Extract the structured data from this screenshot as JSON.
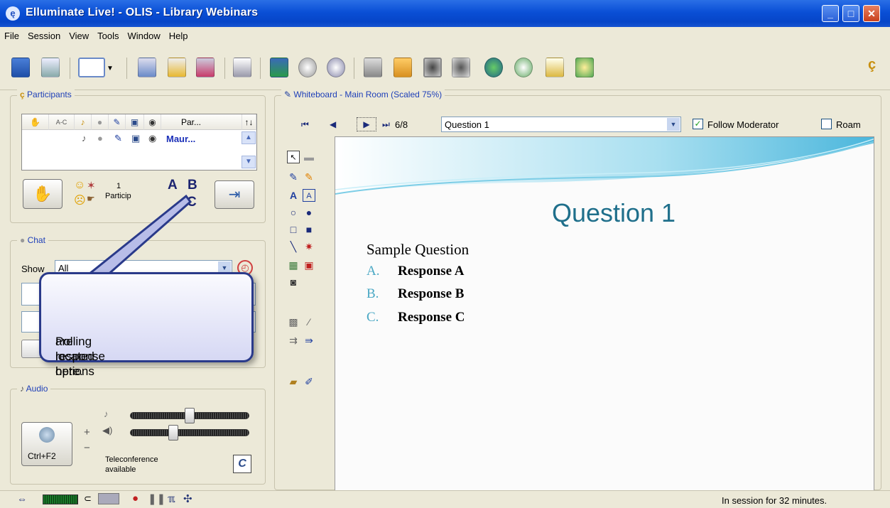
{
  "window": {
    "title": "Elluminate Live! - OLIS - Library Webinars"
  },
  "menu": [
    "File",
    "Session",
    "View",
    "Tools",
    "Window",
    "Help"
  ],
  "toolbar_icons": [
    "save-icon",
    "print-icon",
    "layout-icon",
    "dropdown-arrow-icon",
    "eye-icon",
    "lock-icon",
    "align-icon",
    "projector-icon",
    "desktop-share-icon",
    "cd-icon",
    "settings-icon",
    "load-icon",
    "webcam-icon",
    "webcam-group-icon",
    "globe-icon",
    "timer-icon",
    "notepad-icon",
    "add-user-icon",
    "presence-icon"
  ],
  "participants": {
    "title": "Participants",
    "columns": [
      "",
      "A-C",
      "",
      "",
      "",
      "",
      "",
      "Par..."
    ],
    "sort_label": "↑↓",
    "rows": [
      {
        "name": "Maur..."
      }
    ],
    "count": "1",
    "count_label": "Particip",
    "poll_options": [
      "A",
      "B",
      "C"
    ]
  },
  "chat": {
    "title": "Chat",
    "show_label": "Show",
    "filter_value": "All"
  },
  "audio": {
    "title": "Audio",
    "talk_shortcut": "Ctrl+F2",
    "plus": "+",
    "minus": "−",
    "teleconference": "Teleconference available",
    "mic_level": 0.5,
    "speaker_level": 0.35
  },
  "whiteboard": {
    "title": "Whiteboard - Main Room (Scaled 75%)",
    "page_indicator": "6/8",
    "page_select": "Question 1",
    "follow_label": "Follow Moderator",
    "follow_checked": true,
    "roam_label": "Roam",
    "roam_checked": false
  },
  "slide": {
    "heading": "Question 1",
    "question": "Sample Question",
    "responses": [
      {
        "letter": "A.",
        "text": "Response A"
      },
      {
        "letter": "B.",
        "text": "Response B"
      },
      {
        "letter": "C.",
        "text": "Response C"
      }
    ],
    "heading_color": "#1f6f8b",
    "letter_color": "#4aa8c4"
  },
  "callout": {
    "text_line1": "Polling response options",
    "text_line2": "are located here."
  },
  "status": {
    "session_time": "In session for 32 minutes."
  }
}
